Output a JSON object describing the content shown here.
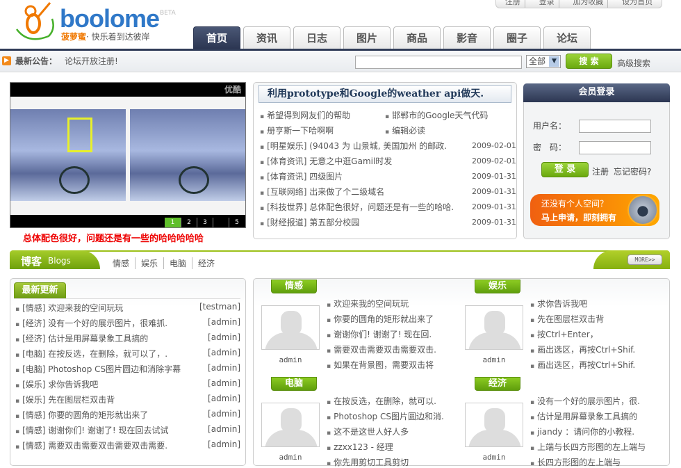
{
  "top_links": [
    "注册",
    "登录",
    "加为收藏",
    "设为首页"
  ],
  "logo": {
    "word": "boolome",
    "beta": "BETA",
    "brand": "菠萝蜜",
    "slogan": "· 快乐着到达彼岸"
  },
  "tabs": [
    "首页",
    "资讯",
    "日志",
    "图片",
    "商品",
    "影音",
    "圈子",
    "论坛"
  ],
  "notice": {
    "label": "最新公告：",
    "text": "论坛开放注册!"
  },
  "search": {
    "value": "",
    "scope": "全部",
    "button": "搜 索",
    "advanced": "高级搜索"
  },
  "slideshow": {
    "watermark": "优酷",
    "pages": [
      "1",
      "2",
      "3",
      "",
      "5"
    ],
    "caption": "总体配色很好，问题还是有一些的哈哈哈哈哈"
  },
  "news": {
    "title": "利用prototype和Google的weather api做天.",
    "top_links": [
      "希望得到网友们的帮助",
      "邯郸市的Google天气代码",
      "册亨斯一下哈啊啊",
      "编辑必读"
    ],
    "items": [
      {
        "text": "[明星娱乐] (94043 为 山景城, 美国加州 的邮政.",
        "date": "2009-02-01"
      },
      {
        "text": "[体育资讯] 无意之中逛Gamil时发",
        "date": "2009-02-01"
      },
      {
        "text": "[体育资讯] 四级图片",
        "date": "2009-01-31"
      },
      {
        "text": "[互联网络] 出来做了个二级域名",
        "date": "2009-01-31"
      },
      {
        "text": "[科技世界] 总体配色很好，问题还是有一些的哈哈.",
        "date": "2009-01-31"
      },
      {
        "text": "[财经报道] 第五部分校园",
        "date": "2009-01-31"
      }
    ]
  },
  "login": {
    "title": "会员登录",
    "username_label": "用户名：",
    "password_label": "密　码：",
    "username": "",
    "password": "",
    "button": "登 录",
    "register": "注册",
    "forgot": "忘记密码?",
    "promo_line1": "还没有个人空间？",
    "promo_line2": "马上申请，即刻拥有"
  },
  "blogs": {
    "title": "博客",
    "subtitle": "Blogs",
    "cats": [
      "情感",
      "娱乐",
      "电脑",
      "经济"
    ],
    "more": "MORE>>"
  },
  "latest": {
    "title": "最新更新",
    "items": [
      {
        "text": "[情感] 欢迎来我的空间玩玩",
        "user": "[testman]"
      },
      {
        "text": "[经济] 没有一个好的展示图片，很难抓.",
        "user": "[admin]"
      },
      {
        "text": "[经济] 估计是用屏幕录象工具搞的",
        "user": "[admin]"
      },
      {
        "text": "[电脑] 在按反选，在删除，就可以了，.",
        "user": "[admin]"
      },
      {
        "text": "[电脑] Photoshop CS图片圆边和消除字幕",
        "user": "[admin]"
      },
      {
        "text": "[娱乐] 求你告诉我吧",
        "user": "[admin]"
      },
      {
        "text": "[娱乐] 先在图层栏双击背",
        "user": "[admin]"
      },
      {
        "text": "[情感] 你要的圆角的矩形就出来了",
        "user": "[admin]"
      },
      {
        "text": "[情感] 谢谢你们! 谢谢了! 现在回去试试",
        "user": "[admin]"
      },
      {
        "text": "[情感] 需要双击需要双击需要双击需要.",
        "user": "[admin]"
      }
    ]
  },
  "categories": [
    {
      "name": "情感",
      "user": "admin",
      "items": [
        "欢迎来我的空间玩玩",
        "你要的圆角的矩形就出来了",
        "谢谢你们! 谢谢了! 现在回.",
        "需要双击需要双击需要双击.",
        "如果在背景图，需要双击将"
      ]
    },
    {
      "name": "娱乐",
      "user": "admin",
      "items": [
        "求你告诉我吧",
        "先在图层栏双击背",
        "按Ctrl+Enter，",
        "画出选区，再按Ctrl+Shif.",
        "画出选区，再按Ctrl+Shif."
      ]
    },
    {
      "name": "电脑",
      "user": "admin",
      "items": [
        "在按反选，在删除，就可以.",
        "Photoshop CS图片圆边和消.",
        "这不是这世人好人多",
        "zzxx123 - 经理",
        "你先用剪切工具剪切"
      ]
    },
    {
      "name": "经济",
      "user": "admin",
      "items": [
        "没有一个好的展示图片，很.",
        "估计是用屏幕录象工具搞的",
        "jiandy ：请问你的小教程.",
        "上端与长四方形图的左上端与",
        "长四方形图的左上端与"
      ]
    }
  ]
}
